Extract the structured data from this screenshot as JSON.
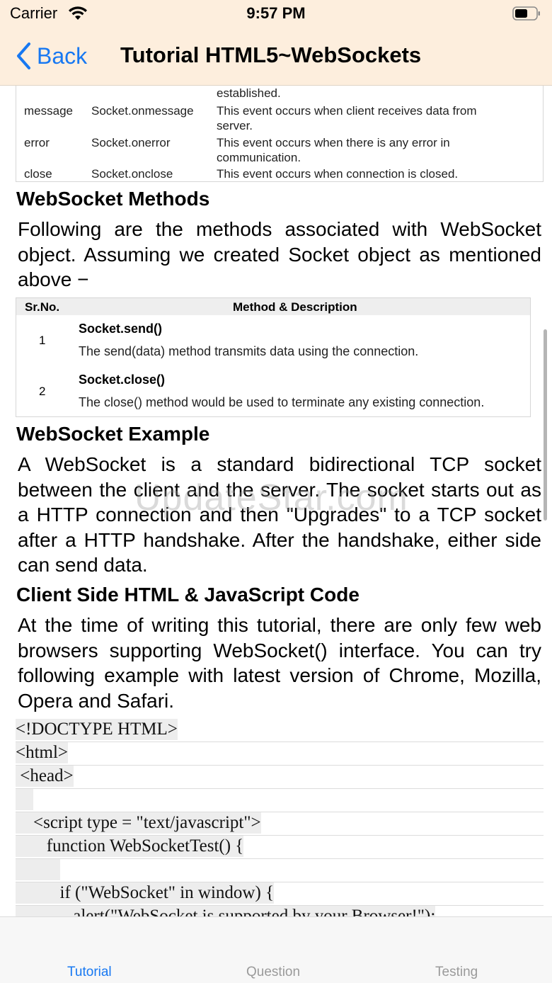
{
  "status_bar": {
    "carrier": "Carrier",
    "time": "9:57 PM"
  },
  "nav": {
    "back_label": "Back",
    "title": "Tutorial HTML5~WebSockets"
  },
  "events_table": {
    "rows": [
      {
        "event": "",
        "handler": "",
        "description": "established."
      },
      {
        "event": "message",
        "handler": "Socket.onmessage",
        "description": "This event occurs when client receives data from server."
      },
      {
        "event": "error",
        "handler": "Socket.onerror",
        "description": "This event occurs when there is any error in communication."
      },
      {
        "event": "close",
        "handler": "Socket.onclose",
        "description": "This event occurs when connection is closed."
      }
    ]
  },
  "sections": {
    "methods_heading": "WebSocket Methods",
    "methods_intro": "Following are the methods associated with WebSocket object. Assuming we created Socket object as mentioned above −",
    "example_heading": "WebSocket Example",
    "example_text": "A WebSocket is a standard bidirectional TCP socket between the client and the server. The socket starts out as a HTTP connection and then \"Upgrades\" to a TCP socket after a HTTP handshake. After the handshake, either side can send data.",
    "client_heading": "Client Side HTML & JavaScript Code",
    "client_text": "At the time of writing this tutorial, there are only few web browsers supporting WebSocket() interface. You can try following example with latest version of Chrome, Mozilla, Opera and Safari."
  },
  "methods_table": {
    "headers": [
      "Sr.No.",
      "Method & Description"
    ],
    "rows": [
      {
        "num": "1",
        "name": "Socket.send()",
        "description": "The send(data) method transmits data using the connection."
      },
      {
        "num": "2",
        "name": "Socket.close()",
        "description": "The close() method would be used to terminate any existing connection."
      }
    ]
  },
  "code_lines": [
    "<!DOCTYPE HTML>",
    "<html>",
    " <head>",
    "    ",
    "    <script type = \"text/javascript\">",
    "       function WebSocketTest() {",
    "          ",
    "          if (\"WebSocket\" in window) {",
    "             alert(\"WebSocket is supported by your Browser!\");"
  ],
  "watermark": "UpdateStar.com",
  "tabs": [
    {
      "label": "Tutorial",
      "active": true
    },
    {
      "label": "Question",
      "active": false
    },
    {
      "label": "Testing",
      "active": false
    }
  ],
  "colors": {
    "accent": "#1778f2",
    "header_bg": "#fdeedd"
  },
  "icons": {
    "wifi": "wifi-icon",
    "battery": "battery-icon",
    "back": "chevron-left-icon"
  }
}
